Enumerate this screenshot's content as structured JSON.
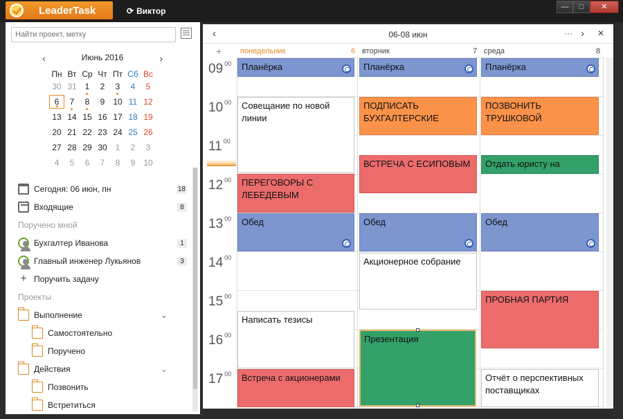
{
  "app": {
    "title": "LeaderTask",
    "user": "Виктор"
  },
  "left": {
    "search_placeholder": "Найти проект, метку",
    "calendar": {
      "title": "Июнь 2016",
      "weekdays": [
        "Пн",
        "Вт",
        "Ср",
        "Чт",
        "Пт",
        "Сб",
        "Вс"
      ],
      "weeks": [
        [
          "30",
          "31",
          "1",
          "2",
          "3",
          "4",
          "5"
        ],
        [
          "6",
          "7",
          "8",
          "9",
          "10",
          "11",
          "12"
        ],
        [
          "13",
          "14",
          "15",
          "16",
          "17",
          "18",
          "19"
        ],
        [
          "20",
          "21",
          "22",
          "23",
          "24",
          "25",
          "26"
        ],
        [
          "27",
          "28",
          "29",
          "30",
          "1",
          "2",
          "3"
        ],
        [
          "4",
          "5",
          "6",
          "7",
          "8",
          "9",
          "10"
        ]
      ]
    },
    "nav": {
      "today": {
        "label": "Сегодня: 06 июн, пн",
        "count": "18"
      },
      "inbox": {
        "label": "Входящие",
        "count": "8"
      },
      "delegated_header": "Поручено мной",
      "people": [
        {
          "label": "Бухгалтер Иванова",
          "count": "1"
        },
        {
          "label": "Главный инженер Лукьянов",
          "count": "3"
        }
      ],
      "assign": "Поручить задачу",
      "projects_header": "Проекты",
      "folders": [
        {
          "label": "Выполнение"
        },
        {
          "label": "Самостоятельно"
        },
        {
          "label": "Поручено"
        },
        {
          "label": "Действия"
        },
        {
          "label": "Позвонить"
        },
        {
          "label": "Встретиться"
        }
      ]
    }
  },
  "right": {
    "range": "06-08 июн",
    "days": [
      {
        "name": "понедельник",
        "num": "6"
      },
      {
        "name": "вторник",
        "num": "7"
      },
      {
        "name": "среда",
        "num": "8"
      }
    ],
    "hours": [
      "09",
      "10",
      "11",
      "12",
      "13",
      "14",
      "15",
      "16",
      "17"
    ],
    "minutes": "00",
    "events": {
      "mon": [
        "Планёрка",
        "Совещание по новой линии",
        "ПЕРЕГОВОРЫ С ЛЕБЕДЕВЫМ",
        "Обед",
        "Написать тезисы",
        "Встреча с акционерами"
      ],
      "tue": [
        "Планёрка",
        "ПОДПИСАТЬ БУХГАЛТЕРСКИЕ",
        "ВСТРЕЧА С ЕСИПОВЫМ",
        "Обед",
        "Акционерное собрание",
        "Презентация"
      ],
      "wed": [
        "Планёрка",
        "ПОЗВОНИТЬ ТРУШКОВОЙ",
        "Отдать юристу на",
        "Обед",
        "ПРОБНАЯ ПАРТИЯ",
        "Отчёт о перспективных поставщиках"
      ]
    },
    "colors": {
      "blue": "#7d96d0",
      "orange": "#fb924a",
      "red": "#ec6c6c",
      "green": "#34a06a",
      "accent": "#e58a20"
    }
  }
}
